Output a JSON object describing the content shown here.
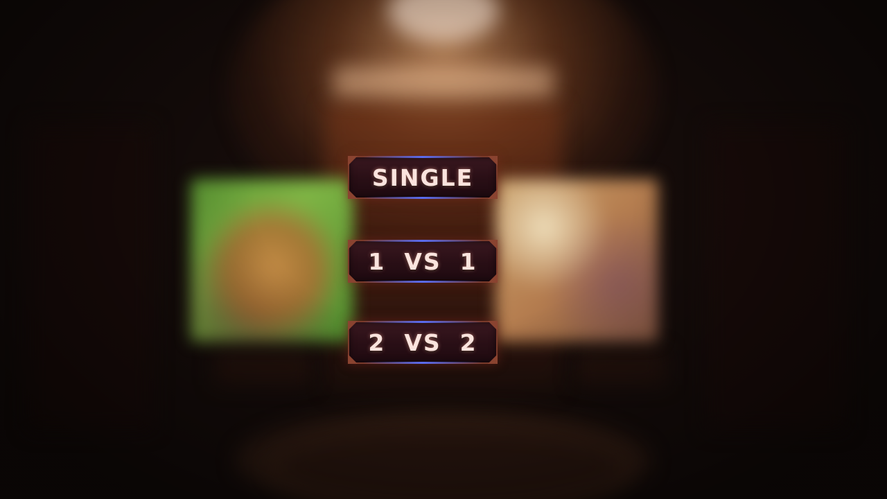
{
  "menu": {
    "modes": [
      {
        "label": "SINGLE"
      },
      {
        "label": "1  VS  1"
      },
      {
        "label": "2  VS  2"
      }
    ]
  },
  "colors": {
    "button_fill": "#2a0f16",
    "button_border": "#7a3a2a",
    "button_accent": "#5a6cf0",
    "label_text": "#fbe4de"
  },
  "icons": [
    "corner-ornament-icon"
  ]
}
